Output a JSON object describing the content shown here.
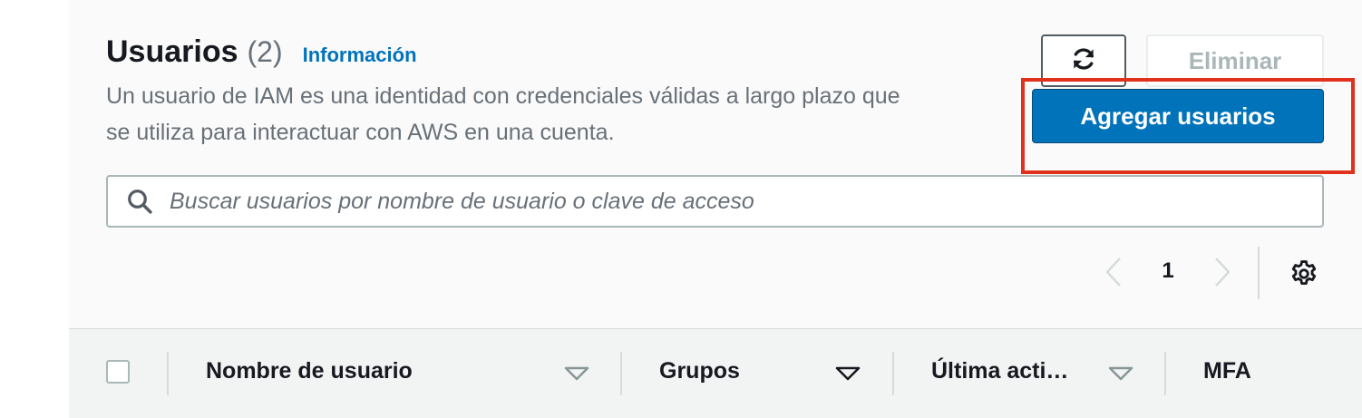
{
  "header": {
    "title": "Usuarios",
    "count": "(2)",
    "info_link": "Información",
    "description": "Un usuario de IAM es una identidad con credenciales válidas a largo plazo que se utiliza para interactuar con AWS en una cuenta."
  },
  "actions": {
    "refresh_icon": "refresh-icon",
    "delete_label": "Eliminar",
    "add_users_label": "Agregar usuarios"
  },
  "search": {
    "placeholder": "Buscar usuarios por nombre de usuario o clave de acceso",
    "value": "",
    "icon": "search-icon"
  },
  "pagination": {
    "current_page": "1",
    "prev_icon": "chevron-left-icon",
    "next_icon": "chevron-right-icon",
    "settings_icon": "gear-icon"
  },
  "table": {
    "columns": [
      {
        "label": "Nombre de usuario",
        "sort_active": false
      },
      {
        "label": "Grupos",
        "sort_active": true
      },
      {
        "label": "Última acti…",
        "sort_active": false
      },
      {
        "label": "MFA",
        "sort_active": false
      }
    ]
  },
  "colors": {
    "primary_button": "#0073bb",
    "link": "#0073bb",
    "highlight": "#e0311d",
    "text": "#16191f",
    "secondary_text": "#687078"
  }
}
